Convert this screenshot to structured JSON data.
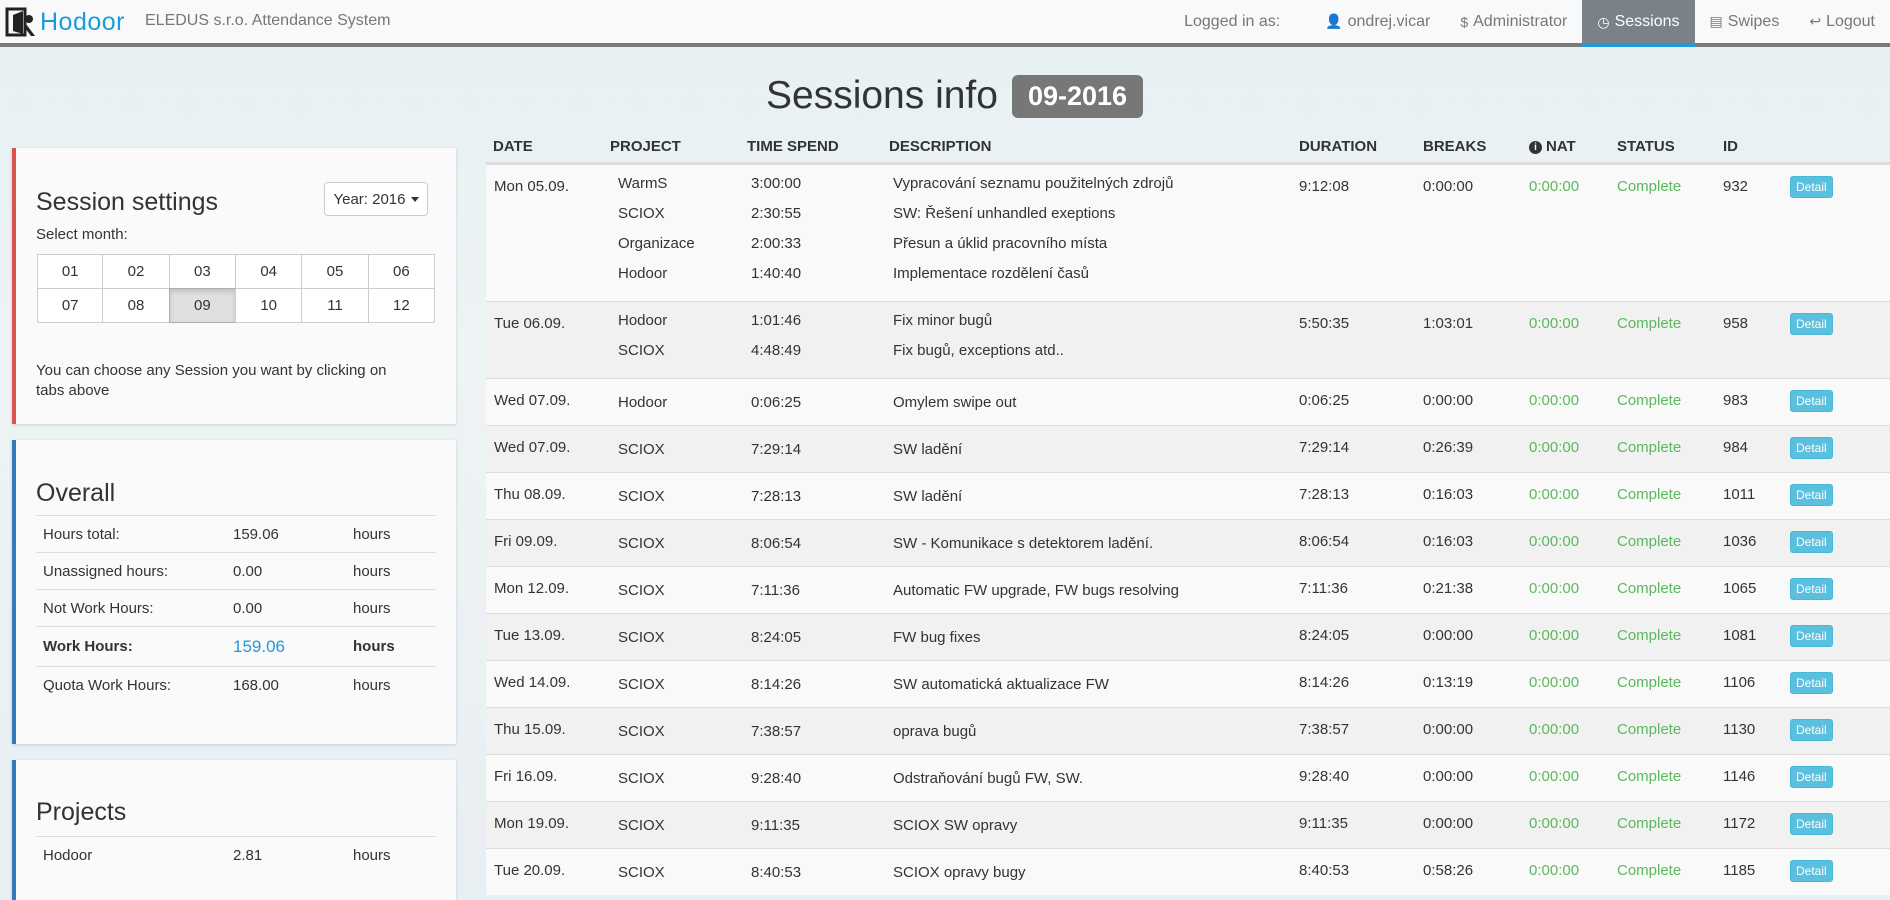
{
  "navbar": {
    "brand": "Hodoor",
    "app_name": "ELEDUS s.r.o. Attendance System",
    "logged_in_label": "Logged in as:",
    "user": "ondrej.vicar",
    "role": "Administrator",
    "items": [
      {
        "label": "Sessions",
        "icon": "clock-icon",
        "active": true
      },
      {
        "label": "Swipes",
        "icon": "list-icon",
        "active": false
      },
      {
        "label": "Logout",
        "icon": "logout-icon",
        "active": false
      }
    ]
  },
  "page": {
    "title": "Sessions info",
    "period_badge": "09-2016"
  },
  "session_settings": {
    "title": "Session settings",
    "year_button": "Year: 2016",
    "select_month_label": "Select month:",
    "months": [
      "01",
      "02",
      "03",
      "04",
      "05",
      "06",
      "07",
      "08",
      "09",
      "10",
      "11",
      "12"
    ],
    "active_month": "09",
    "hint": "You can choose any Session you want by clicking on tabs above"
  },
  "overall": {
    "title": "Overall",
    "rows": [
      {
        "label": "Hours total:",
        "value": "159.06",
        "unit": "hours"
      },
      {
        "label": "Unassigned hours:",
        "value": "0.00",
        "unit": "hours"
      },
      {
        "label": "Not Work Hours:",
        "value": "0.00",
        "unit": "hours"
      },
      {
        "label": "Work Hours:",
        "value": "159.06",
        "unit": "hours"
      },
      {
        "label": "Quota Work Hours:",
        "value": "168.00",
        "unit": "hours"
      }
    ]
  },
  "projects": {
    "title": "Projects",
    "rows": [
      {
        "label": "Hodoor",
        "value": "2.81",
        "unit": "hours"
      }
    ]
  },
  "sessions_table": {
    "headers": {
      "date": "DATE",
      "project": "PROJECT",
      "time_spend": "TIME SPEND",
      "description": "DESCRIPTION",
      "duration": "DURATION",
      "breaks": "BREAKS",
      "nat": "NAT",
      "status": "STATUS",
      "id": "ID"
    },
    "detail_label": "Detail",
    "rows": [
      {
        "date": "Mon 05.09.",
        "entries": [
          {
            "project": "WarmS",
            "time": "3:00:00",
            "desc": "Vypracování seznamu použitelných zdrojů"
          },
          {
            "project": "SCIOX",
            "time": "2:30:55",
            "desc": "SW: Řešení unhandled exeptions"
          },
          {
            "project": "Organizace",
            "time": "2:00:33",
            "desc": "Přesun a úklid pracovního místa"
          },
          {
            "project": "Hodoor",
            "time": "1:40:40",
            "desc": "Implementace rozdělení časů"
          }
        ],
        "duration": "9:12:08",
        "breaks": "0:00:00",
        "nat": "0:00:00",
        "status": "Complete",
        "id": "932"
      },
      {
        "date": "Tue 06.09.",
        "entries": [
          {
            "project": "Hodoor",
            "time": "1:01:46",
            "desc": "Fix minor bugů"
          },
          {
            "project": "SCIOX",
            "time": "4:48:49",
            "desc": "Fix bugů, exceptions atd.."
          }
        ],
        "duration": "5:50:35",
        "breaks": "1:03:01",
        "nat": "0:00:00",
        "status": "Complete",
        "id": "958"
      },
      {
        "date": "Wed 07.09.",
        "entries": [
          {
            "project": "Hodoor",
            "time": "0:06:25",
            "desc": "Omylem swipe out"
          }
        ],
        "duration": "0:06:25",
        "breaks": "0:00:00",
        "nat": "0:00:00",
        "status": "Complete",
        "id": "983"
      },
      {
        "date": "Wed 07.09.",
        "entries": [
          {
            "project": "SCIOX",
            "time": "7:29:14",
            "desc": "SW ladění"
          }
        ],
        "duration": "7:29:14",
        "breaks": "0:26:39",
        "nat": "0:00:00",
        "status": "Complete",
        "id": "984"
      },
      {
        "date": "Thu 08.09.",
        "entries": [
          {
            "project": "SCIOX",
            "time": "7:28:13",
            "desc": "SW ladění"
          }
        ],
        "duration": "7:28:13",
        "breaks": "0:16:03",
        "nat": "0:00:00",
        "status": "Complete",
        "id": "1011"
      },
      {
        "date": "Fri 09.09.",
        "entries": [
          {
            "project": "SCIOX",
            "time": "8:06:54",
            "desc": "SW - Komunikace s detektorem ladění."
          }
        ],
        "duration": "8:06:54",
        "breaks": "0:16:03",
        "nat": "0:00:00",
        "status": "Complete",
        "id": "1036"
      },
      {
        "date": "Mon 12.09.",
        "entries": [
          {
            "project": "SCIOX",
            "time": "7:11:36",
            "desc": "Automatic FW upgrade, FW bugs resolving"
          }
        ],
        "duration": "7:11:36",
        "breaks": "0:21:38",
        "nat": "0:00:00",
        "status": "Complete",
        "id": "1065"
      },
      {
        "date": "Tue 13.09.",
        "entries": [
          {
            "project": "SCIOX",
            "time": "8:24:05",
            "desc": "FW bug fixes"
          }
        ],
        "duration": "8:24:05",
        "breaks": "0:00:00",
        "nat": "0:00:00",
        "status": "Complete",
        "id": "1081"
      },
      {
        "date": "Wed 14.09.",
        "entries": [
          {
            "project": "SCIOX",
            "time": "8:14:26",
            "desc": "SW automatická aktualizace FW"
          }
        ],
        "duration": "8:14:26",
        "breaks": "0:13:19",
        "nat": "0:00:00",
        "status": "Complete",
        "id": "1106"
      },
      {
        "date": "Thu 15.09.",
        "entries": [
          {
            "project": "SCIOX",
            "time": "7:38:57",
            "desc": "oprava bugů"
          }
        ],
        "duration": "7:38:57",
        "breaks": "0:00:00",
        "nat": "0:00:00",
        "status": "Complete",
        "id": "1130"
      },
      {
        "date": "Fri 16.09.",
        "entries": [
          {
            "project": "SCIOX",
            "time": "9:28:40",
            "desc": "Odstraňování bugů FW, SW."
          }
        ],
        "duration": "9:28:40",
        "breaks": "0:00:00",
        "nat": "0:00:00",
        "status": "Complete",
        "id": "1146"
      },
      {
        "date": "Mon 19.09.",
        "entries": [
          {
            "project": "SCIOX",
            "time": "9:11:35",
            "desc": "SCIOX SW opravy"
          }
        ],
        "duration": "9:11:35",
        "breaks": "0:00:00",
        "nat": "0:00:00",
        "status": "Complete",
        "id": "1172"
      },
      {
        "date": "Tue 20.09.",
        "entries": [
          {
            "project": "SCIOX",
            "time": "8:40:53",
            "desc": "SCIOX opravy bugy"
          }
        ],
        "duration": "8:40:53",
        "breaks": "0:58:26",
        "nat": "0:00:00",
        "status": "Complete",
        "id": "1185"
      }
    ]
  },
  "colors": {
    "brand": "#1e9bd7",
    "status_green": "#5cb85c",
    "detail_button": "#5bc0de",
    "badge": "#777777"
  }
}
